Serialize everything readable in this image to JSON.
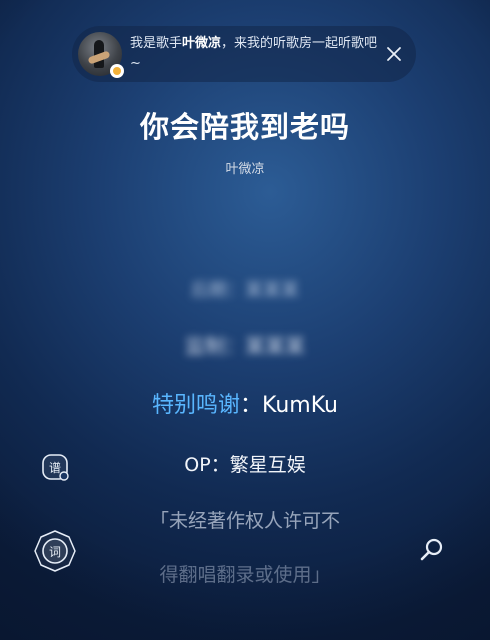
{
  "banner": {
    "text_prefix": "我是歌手",
    "singer_highlight": "叶微凉",
    "text_suffix": "，来我的听歌房一起听歌吧~"
  },
  "song": {
    "title": "你会陪我到老吗",
    "singer": "叶微凉"
  },
  "lyrics": {
    "blurred_1": "后期：某某某",
    "blurred_2": "监制：某某某",
    "active_highlight": "特别鸣谢",
    "active_rest": "：KumKu",
    "line_op": "OP：繁星互娱",
    "line_copyright_1": "「未经著作权人许可不",
    "line_copyright_2": "得翻唱翻录或使用」"
  },
  "controls": {
    "score_glyph": "谱",
    "lyric_glyph": "词"
  },
  "colors": {
    "accent": "#59b6ff",
    "badge": "#f2b13a",
    "background": "#1c3f72"
  },
  "icons": {
    "close": "close-icon",
    "search": "search-icon",
    "score": "score-icon",
    "lyric": "lyric-icon"
  }
}
